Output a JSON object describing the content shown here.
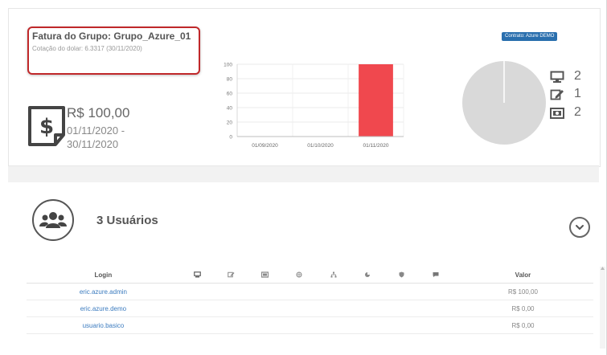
{
  "invoice": {
    "group_title": "Fatura do Grupo: Grupo_Azure_01",
    "exchange_rate": "Cotação do dolar: 6.3317 (30/11/2020)",
    "amount": "R$ 100,00",
    "period_start": "01/11/2020 -",
    "period_end": "30/11/2020"
  },
  "contract_badge": "Contrato: Azure DEMO",
  "chart_data": {
    "type": "bar",
    "categories": [
      "01/09/2020",
      "01/10/2020",
      "01/11/2020"
    ],
    "values": [
      0,
      0,
      100
    ],
    "ylim": [
      0,
      100
    ],
    "yticks": [
      "100",
      "80",
      "60",
      "40",
      "20",
      "0"
    ],
    "bar_color": "#f0484e",
    "grid": true
  },
  "pie": {
    "color": "#d9d9d9",
    "slice_line_color": "#ffffff"
  },
  "device_stats": [
    {
      "icon": "desktop-icon",
      "count": "2"
    },
    {
      "icon": "edit-icon",
      "count": "1"
    },
    {
      "icon": "license-icon",
      "count": "2"
    }
  ],
  "users_section": {
    "title": "3 Usuários",
    "columns": {
      "login": "Login",
      "value": "Valor"
    },
    "icon_columns": [
      "desktop-icon",
      "edit-icon",
      "license-icon",
      "globe-icon",
      "sitemap-icon",
      "pie-chart-icon",
      "shield-icon",
      "message-icon"
    ],
    "rows": [
      {
        "login": "eric.azure.admin",
        "value": "R$ 100,00"
      },
      {
        "login": "eric.azure.demo",
        "value": "R$ 0,00"
      },
      {
        "login": "usuario.basico",
        "value": "R$ 0,00"
      }
    ]
  }
}
